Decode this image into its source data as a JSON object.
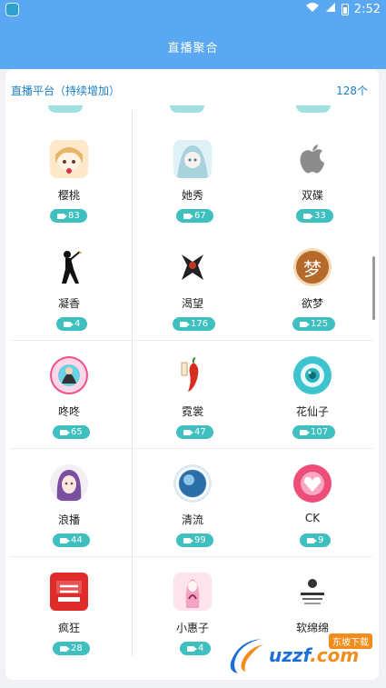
{
  "status_bar": {
    "time": "2:52",
    "wifi_icon": "wifi-icon",
    "signal_icon": "signal-icon",
    "battery_icon": "battery-icon"
  },
  "app_bar": {
    "title": "直播聚合"
  },
  "platforms_header": {
    "title": "直播平台（持续增加）",
    "count": "128个"
  },
  "platforms": [
    {
      "name": "樱桃",
      "viewers": "83",
      "logo_icon": "anime-girl-icon"
    },
    {
      "name": "她秀",
      "viewers": "67",
      "logo_icon": "anime-girl-blue-icon"
    },
    {
      "name": "双碟",
      "viewers": "33",
      "logo_icon": "apple-icon"
    },
    {
      "name": "凝香",
      "viewers": "4",
      "logo_icon": "dancer-silhouette-icon"
    },
    {
      "name": "渴望",
      "viewers": "176",
      "logo_icon": "dark-figure-icon"
    },
    {
      "name": "欲梦",
      "viewers": "125",
      "logo_icon": "meng-character-icon"
    },
    {
      "name": "咚咚",
      "viewers": "65",
      "logo_icon": "pink-circle-logo-icon"
    },
    {
      "name": "霓裳",
      "viewers": "47",
      "logo_icon": "chili-pepper-icon"
    },
    {
      "name": "花仙子",
      "viewers": "107",
      "logo_icon": "camera-lens-icon"
    },
    {
      "name": "浪播",
      "viewers": "44",
      "logo_icon": "purple-hair-girl-icon"
    },
    {
      "name": "清流",
      "viewers": "99",
      "logo_icon": "blue-orb-icon"
    },
    {
      "name": "CK",
      "viewers": "9",
      "logo_icon": "pink-heart-hand-icon"
    },
    {
      "name": "疯狂",
      "viewers": "28",
      "logo_icon": "red-square-logo-icon"
    },
    {
      "name": "小惠子",
      "viewers": "4",
      "logo_icon": "pink-figure-icon"
    },
    {
      "name": "软绵绵",
      "viewers": "",
      "logo_icon": "text-logo-icon"
    }
  ],
  "colors": {
    "app_bar": "#5aa8f2",
    "badge": "#3fbfbf",
    "header_text": "#1b7fc6"
  },
  "watermark": {
    "text_main": "uzzf",
    "text_suffix": ".com",
    "tag": "东坡下载"
  }
}
